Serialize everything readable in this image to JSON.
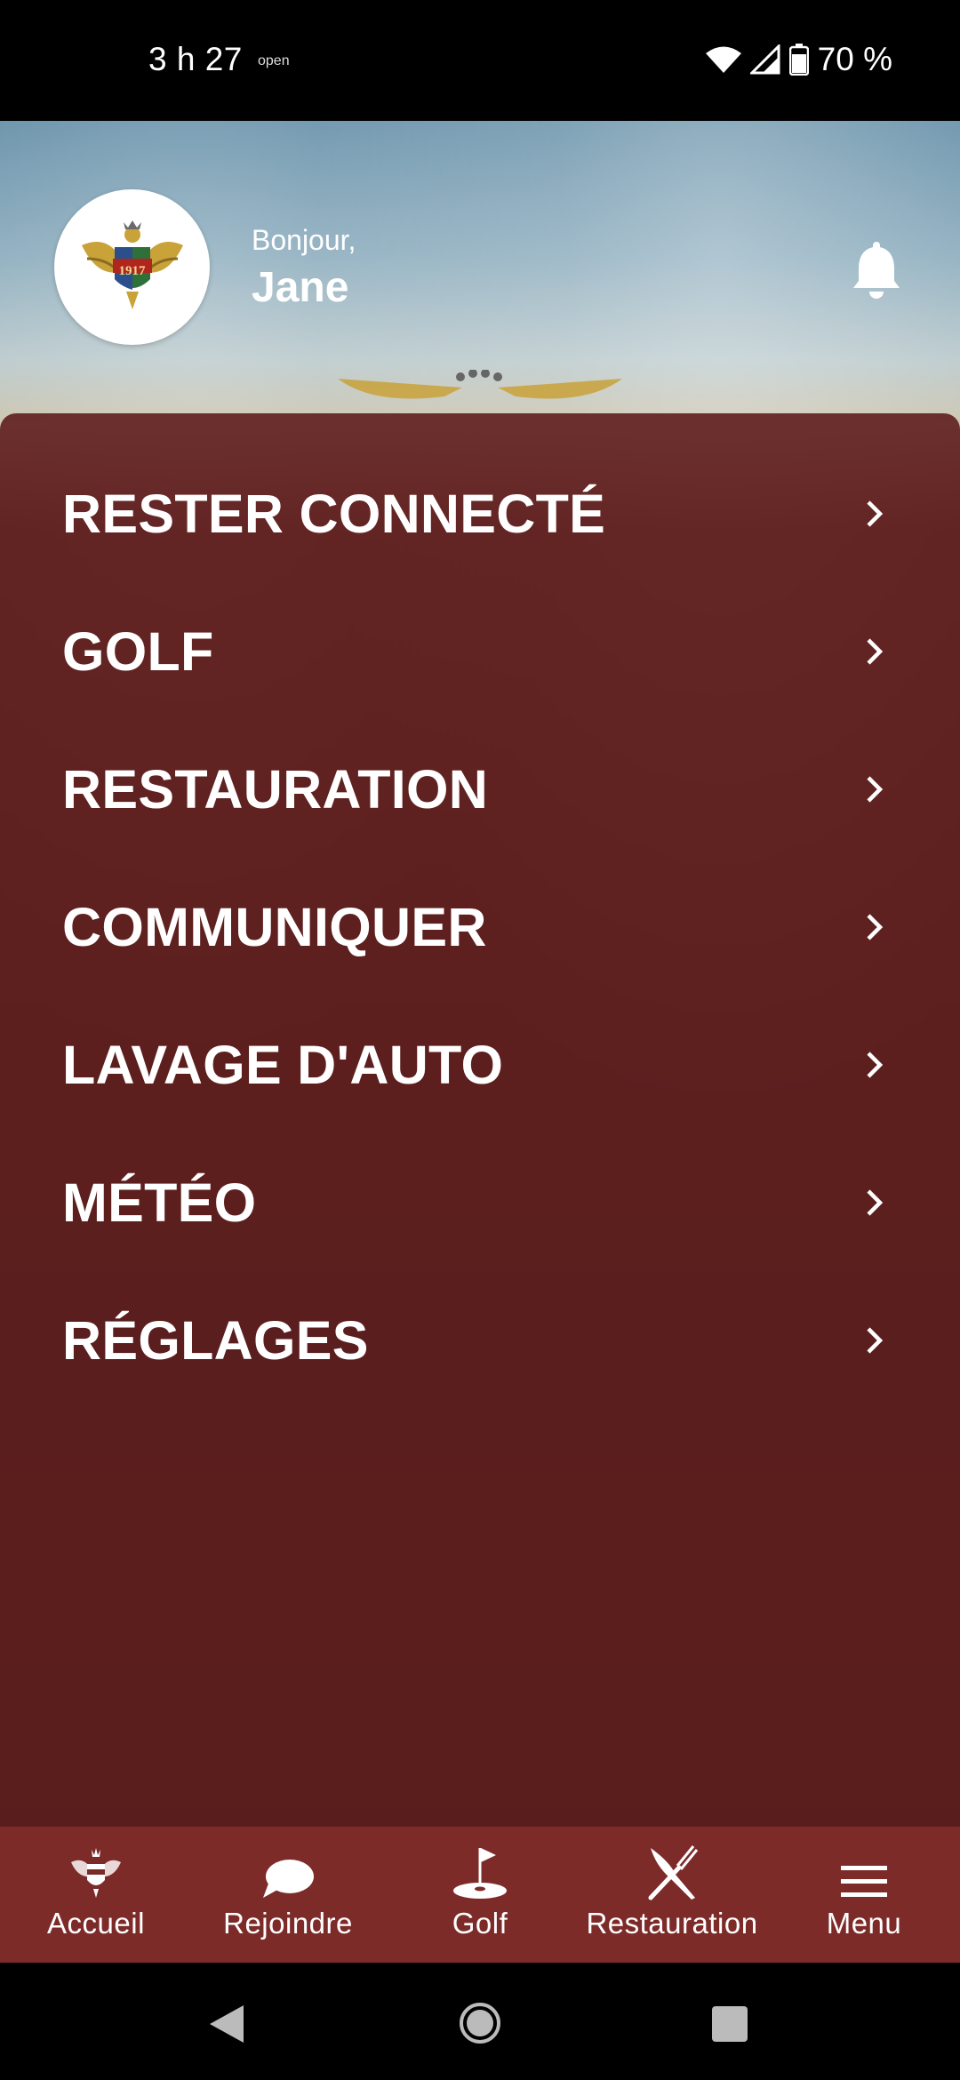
{
  "status_bar": {
    "time": "3 h 27",
    "extra": "open",
    "battery": "70 %"
  },
  "header": {
    "logo_year": "1917",
    "greeting": "Bonjour,",
    "user_name": "Jane"
  },
  "menu": {
    "items": [
      {
        "label": "RESTER CONNECTÉ"
      },
      {
        "label": "GOLF"
      },
      {
        "label": "RESTAURATION"
      },
      {
        "label": "COMMUNIQUER"
      },
      {
        "label": "LAVAGE D'AUTO"
      },
      {
        "label": "MÉTÉO"
      },
      {
        "label": "RÉGLAGES"
      }
    ]
  },
  "bottom_nav": {
    "items": [
      {
        "label": "Accueil",
        "icon": "crest-icon"
      },
      {
        "label": "Rejoindre",
        "icon": "chat-bubble-icon"
      },
      {
        "label": "Golf",
        "icon": "golf-flag-icon"
      },
      {
        "label": "Restauration",
        "icon": "fork-knife-icon"
      },
      {
        "label": "Menu",
        "icon": "hamburger-icon"
      }
    ]
  },
  "colors": {
    "panel": "#5f1e1e",
    "nav_bar": "#7c2b29",
    "gold": "#c9a23a"
  }
}
